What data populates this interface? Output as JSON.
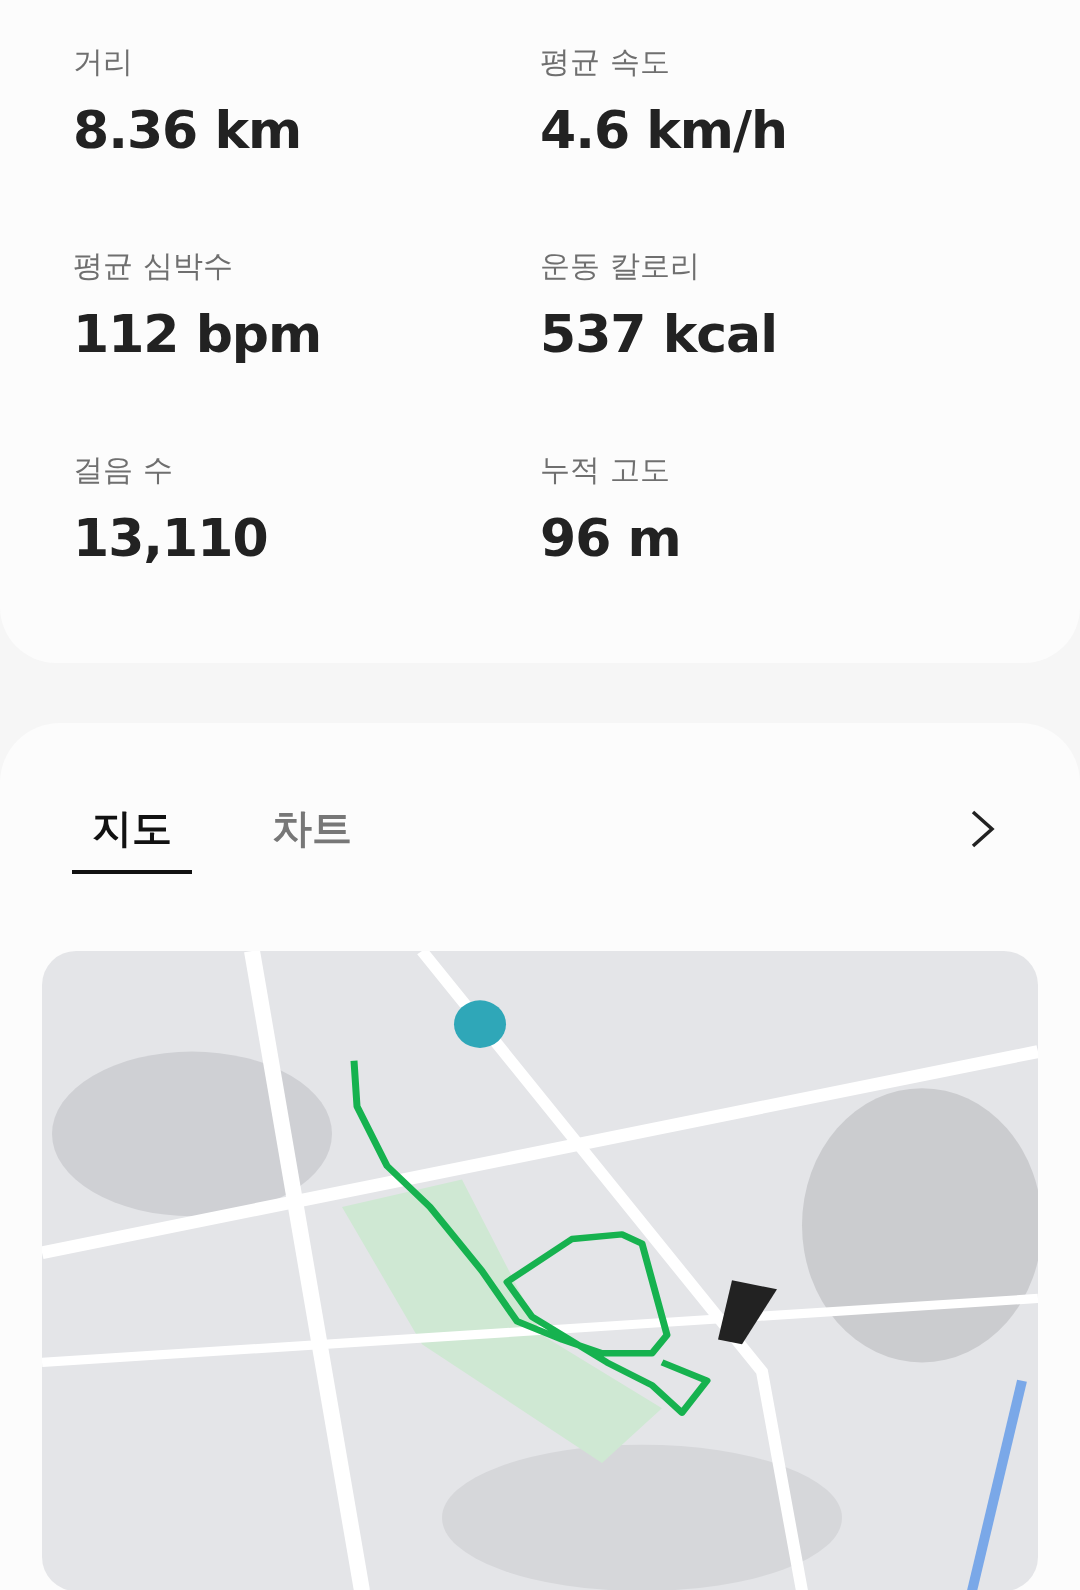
{
  "stats": [
    {
      "label": "거리",
      "value": "8.36 km"
    },
    {
      "label": "평균 속도",
      "value": "4.6 km/h"
    },
    {
      "label": "평균 심박수",
      "value": "112 bpm"
    },
    {
      "label": "운동 칼로리",
      "value": "537 kcal"
    },
    {
      "label": "걸음 수",
      "value": "13,110"
    },
    {
      "label": "누적 고도",
      "value": "96 m"
    }
  ],
  "tabs": [
    {
      "label": "지도",
      "selected": true
    },
    {
      "label": "차트",
      "selected": false
    }
  ]
}
